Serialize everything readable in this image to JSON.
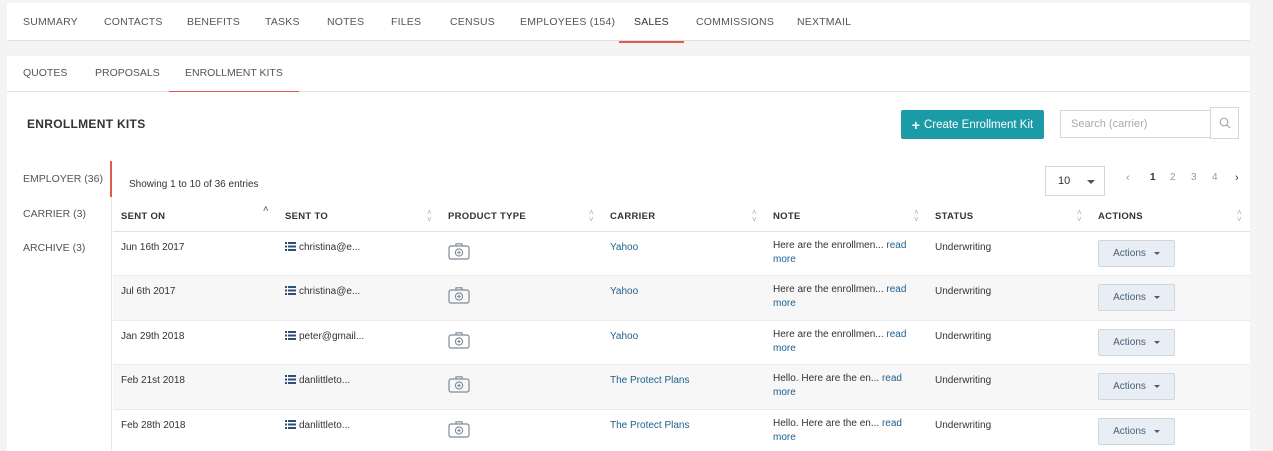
{
  "top_tabs": [
    {
      "label": "SUMMARY"
    },
    {
      "label": "CONTACTS"
    },
    {
      "label": "BENEFITS"
    },
    {
      "label": "TASKS"
    },
    {
      "label": "NOTES"
    },
    {
      "label": "FILES"
    },
    {
      "label": "CENSUS"
    },
    {
      "label": "EMPLOYEES (154)"
    },
    {
      "label": "SALES"
    },
    {
      "label": "COMMISSIONS"
    },
    {
      "label": "NEXTMAIL"
    }
  ],
  "top_tabs_active": "SALES",
  "sub_tabs": [
    {
      "label": "QUOTES"
    },
    {
      "label": "PROPOSALS"
    },
    {
      "label": "ENROLLMENT KITS"
    }
  ],
  "sub_tabs_active": "ENROLLMENT KITS",
  "panel": {
    "title": "ENROLLMENT KITS",
    "create_label": "Create Enrollment Kit",
    "search_placeholder": "Search (carrier)"
  },
  "side_filters": [
    {
      "label": "EMPLOYER (36)"
    },
    {
      "label": "CARRIER (3)"
    },
    {
      "label": "ARCHIVE (3)"
    }
  ],
  "table": {
    "showing": "Showing 1 to 10 of 36 entries",
    "page_size": "10",
    "pages": [
      "1",
      "2",
      "3",
      "4"
    ],
    "current_page": "1",
    "prev": "‹",
    "next": "›",
    "columns": [
      "SENT ON",
      "SENT TO",
      "PRODUCT TYPE",
      "CARRIER",
      "NOTE",
      "STATUS",
      "ACTIONS"
    ],
    "rows": [
      {
        "sent_on": "Jun 16th 2017",
        "sent_to": "christina@e...",
        "carrier": "Yahoo",
        "note": "Here are the enrollmen...",
        "status": "Underwriting",
        "action": "Actions"
      },
      {
        "sent_on": "Jul 6th 2017",
        "sent_to": "christina@e...",
        "carrier": "Yahoo",
        "note": "Here are the enrollmen...",
        "status": "Underwriting",
        "action": "Actions"
      },
      {
        "sent_on": "Jan 29th 2018",
        "sent_to": "peter@gmail...",
        "carrier": "Yahoo",
        "note": "Here are the enrollmen...",
        "status": "Underwriting",
        "action": "Actions"
      },
      {
        "sent_on": "Feb 21st 2018",
        "sent_to": "danlittleto...",
        "carrier": "The Protect Plans",
        "note": "Hello. Here are the en...",
        "status": "Underwriting",
        "action": "Actions"
      },
      {
        "sent_on": "Feb 28th 2018",
        "sent_to": "danlittleto...",
        "carrier": "The Protect Plans",
        "note": "Hello. Here are the en...",
        "status": "Underwriting",
        "action": "Actions"
      }
    ],
    "read_more_a": "read",
    "read_more_b": "more"
  },
  "colors": {
    "accent": "#e05a4f",
    "primary_button": "#1a9ba5",
    "link": "#1d5f8c"
  }
}
